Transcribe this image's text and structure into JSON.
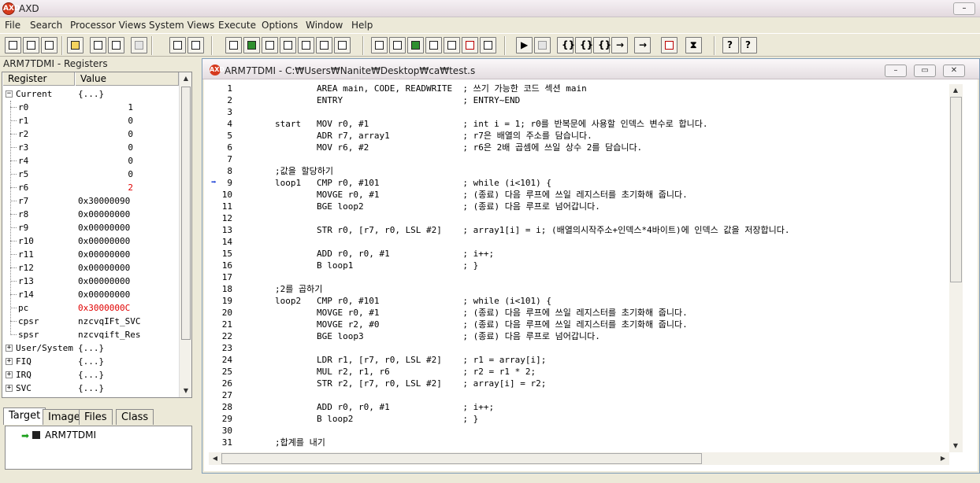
{
  "app": {
    "title": "AXD",
    "logo_text": "AXD"
  },
  "menu": [
    "File",
    "Search",
    "Processor Views",
    "System Views",
    "Execute",
    "Options",
    "Window",
    "Help"
  ],
  "registers_panel": {
    "title": "ARM7TDMI - Registers",
    "columns": [
      "Register",
      "Value"
    ],
    "current_group": {
      "name": "Current",
      "value": "{...}"
    },
    "rows": [
      {
        "name": "r0",
        "value": "1"
      },
      {
        "name": "r1",
        "value": "0"
      },
      {
        "name": "r2",
        "value": "0"
      },
      {
        "name": "r3",
        "value": "0"
      },
      {
        "name": "r4",
        "value": "0"
      },
      {
        "name": "r5",
        "value": "0"
      },
      {
        "name": "r6",
        "value": "2"
      },
      {
        "name": "r7",
        "value": "0x30000090"
      },
      {
        "name": "r8",
        "value": "0x00000000"
      },
      {
        "name": "r9",
        "value": "0x00000000"
      },
      {
        "name": "r10",
        "value": "0x00000000"
      },
      {
        "name": "r11",
        "value": "0x00000000"
      },
      {
        "name": "r12",
        "value": "0x00000000"
      },
      {
        "name": "r13",
        "value": "0x00000000"
      },
      {
        "name": "r14",
        "value": "0x00000000"
      },
      {
        "name": "pc",
        "value": "0x3000000C"
      },
      {
        "name": "cpsr",
        "value": "nzcvqIFt_SVC"
      },
      {
        "name": "spsr",
        "value": "nzcvqift_Res"
      }
    ],
    "changed_color": "#e00000",
    "groups": [
      {
        "name": "User/System",
        "value": "{...}"
      },
      {
        "name": "FIQ",
        "value": "{...}"
      },
      {
        "name": "IRQ",
        "value": "{...}"
      },
      {
        "name": "SVC",
        "value": "{...}"
      }
    ]
  },
  "tabs_panel": {
    "tabs": [
      "Target",
      "Image",
      "Files",
      "Class"
    ],
    "active_tab": "Target",
    "target_item": "ARM7TDMI"
  },
  "source_window": {
    "title": "ARM7TDMI - C:₩Users₩Nanite₩Desktop₩ca₩test.s",
    "current_line": 9,
    "lines": [
      {
        "n": "1",
        "text": "        AREA main, CODE, READWRITE  ; 쓰기 가능한 코드 섹션 main"
      },
      {
        "n": "2",
        "text": "        ENTRY                       ; ENTRY~END"
      },
      {
        "n": "3",
        "text": ""
      },
      {
        "n": "4",
        "text": "start   MOV r0, #1                  ; int i = 1; r0를 반복문에 사용할 인덱스 변수로 합니다."
      },
      {
        "n": "5",
        "text": "        ADR r7, array1              ; r7은 배열의 주소를 담습니다."
      },
      {
        "n": "6",
        "text": "        MOV r6, #2                  ; r6은 2배 곱셈에 쓰일 상수 2를 담습니다."
      },
      {
        "n": "7",
        "text": ""
      },
      {
        "n": "8",
        "text": ";값을 할당하기"
      },
      {
        "n": "9",
        "text": "loop1   CMP r0, #101                ; while (i<101) {"
      },
      {
        "n": "10",
        "text": "        MOVGE r0, #1                ; (종료) 다음 루프에 쓰일 레지스터를 초기화해 줍니다."
      },
      {
        "n": "11",
        "text": "        BGE loop2                   ; (종료) 다음 루프로 넘어갑니다."
      },
      {
        "n": "12",
        "text": ""
      },
      {
        "n": "13",
        "text": "        STR r0, [r7, r0, LSL #2]    ; array1[i] = i; (배열의시작주소+인덱스*4바이트)에 인덱스 값을 저장합니다."
      },
      {
        "n": "14",
        "text": ""
      },
      {
        "n": "15",
        "text": "        ADD r0, r0, #1              ; i++;"
      },
      {
        "n": "16",
        "text": "        B loop1                     ; }"
      },
      {
        "n": "17",
        "text": ""
      },
      {
        "n": "18",
        "text": ";2를 곱하기"
      },
      {
        "n": "19",
        "text": "loop2   CMP r0, #101                ; while (i<101) {"
      },
      {
        "n": "20",
        "text": "        MOVGE r0, #1                ; (종료) 다음 루프에 쓰일 레지스터를 초기화해 줍니다."
      },
      {
        "n": "21",
        "text": "        MOVGE r2, #0                ; (종료) 다음 루프에 쓰일 레지스터를 초기화해 줍니다."
      },
      {
        "n": "22",
        "text": "        BGE loop3                   ; (종료) 다음 루프로 넘어갑니다."
      },
      {
        "n": "23",
        "text": ""
      },
      {
        "n": "24",
        "text": "        LDR r1, [r7, r0, LSL #2]    ; r1 = array[i];"
      },
      {
        "n": "25",
        "text": "        MUL r2, r1, r6              ; r2 = r1 * 2;"
      },
      {
        "n": "26",
        "text": "        STR r2, [r7, r0, LSL #2]    ; array[i] = r2;"
      },
      {
        "n": "27",
        "text": ""
      },
      {
        "n": "28",
        "text": "        ADD r0, r0, #1              ; i++;"
      },
      {
        "n": "29",
        "text": "        B loop2                     ; }"
      },
      {
        "n": "30",
        "text": ""
      },
      {
        "n": "31",
        "text": ";합계를 내기"
      }
    ]
  }
}
